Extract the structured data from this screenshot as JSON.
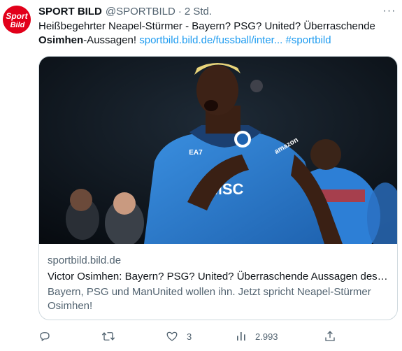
{
  "tweet": {
    "display_name": "SPORT BILD",
    "handle": "@SPORTBILD",
    "separator": "·",
    "time": "2 Std.",
    "more_label": "···",
    "text_line1": "Heißbegehrter Neapel-Stürmer - Bayern? PSG? United? Überraschende",
    "text_bold": "Osimhen",
    "text_after_bold": "-Aussagen! ",
    "text_link": "sportbild.bild.de/fussball/inter...",
    "text_space": " ",
    "text_hashtag": "#sportbild"
  },
  "avatar": {
    "logo_line1": "Sport",
    "logo_line2": "Bild",
    "brand_color": "#e2001a"
  },
  "card": {
    "domain": "sportbild.bild.de",
    "title": "Victor Osimhen: Bayern? PSG? United? Überraschende Aussagen des Neapel-Stürmers",
    "description": "Bayern, PSG und ManUnited wollen ihn. Jetzt spricht Neapel-Stürmer Osimhen!",
    "jersey_text": "MSC",
    "jersey_brand": "EA7",
    "sleeve_text": "amazon"
  },
  "actions": {
    "reply_count": "",
    "retweet_count": "",
    "like_count": "3",
    "views_count": "2.993"
  },
  "colors": {
    "link": "#1d9bf0",
    "muted": "#536471",
    "napoli_blue": "#2a7fd0"
  }
}
